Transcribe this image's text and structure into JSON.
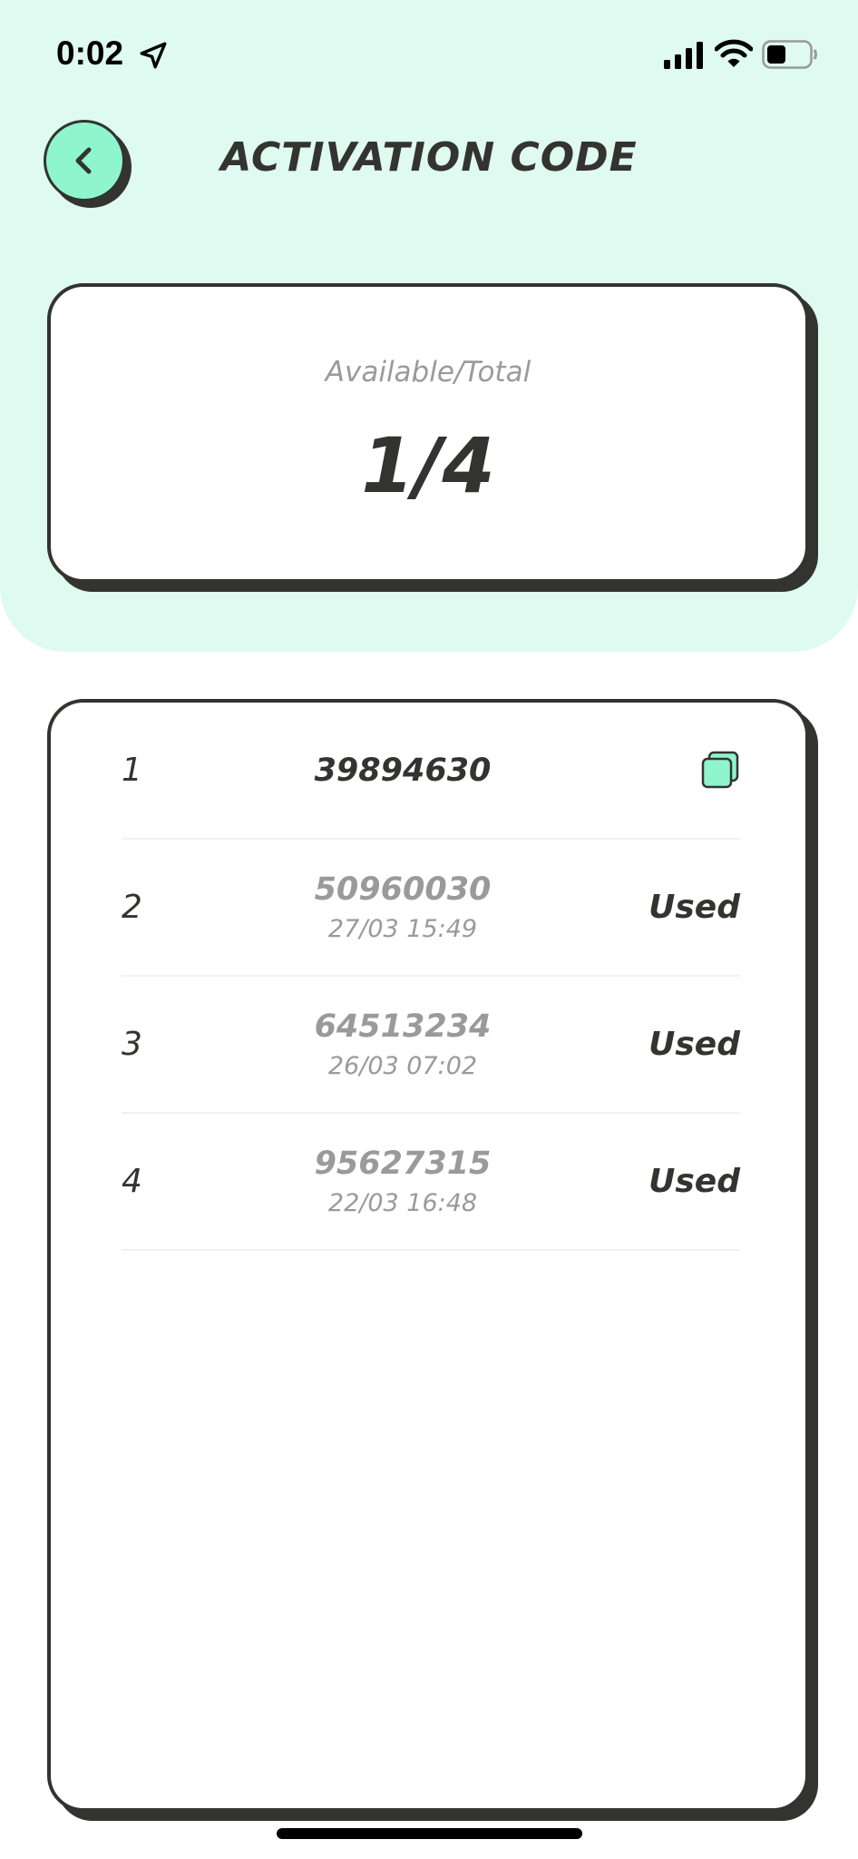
{
  "status_bar": {
    "time": "0:02",
    "icons": [
      "location-arrow-icon",
      "signal-icon",
      "wifi-icon",
      "battery-icon"
    ]
  },
  "header": {
    "title": "ACTIVATION CODE",
    "back_icon": "chevron-left-icon"
  },
  "summary": {
    "label": "Available/Total",
    "value": "1/4"
  },
  "codes": [
    {
      "index": "1",
      "code": "39894630",
      "date": "",
      "status": "",
      "action_icon": "copy-icon",
      "used": false
    },
    {
      "index": "2",
      "code": "50960030",
      "date": "27/03 15:49",
      "status": "Used",
      "used": true
    },
    {
      "index": "3",
      "code": "64513234",
      "date": "26/03 07:02",
      "status": "Used",
      "used": true
    },
    {
      "index": "4",
      "code": "95627315",
      "date": "22/03 16:48",
      "status": "Used",
      "used": true
    }
  ],
  "colors": {
    "accent_mint": "#8ef5cd",
    "header_bg": "#dffaf0",
    "ink": "#333330",
    "muted": "#9a9a9a"
  }
}
